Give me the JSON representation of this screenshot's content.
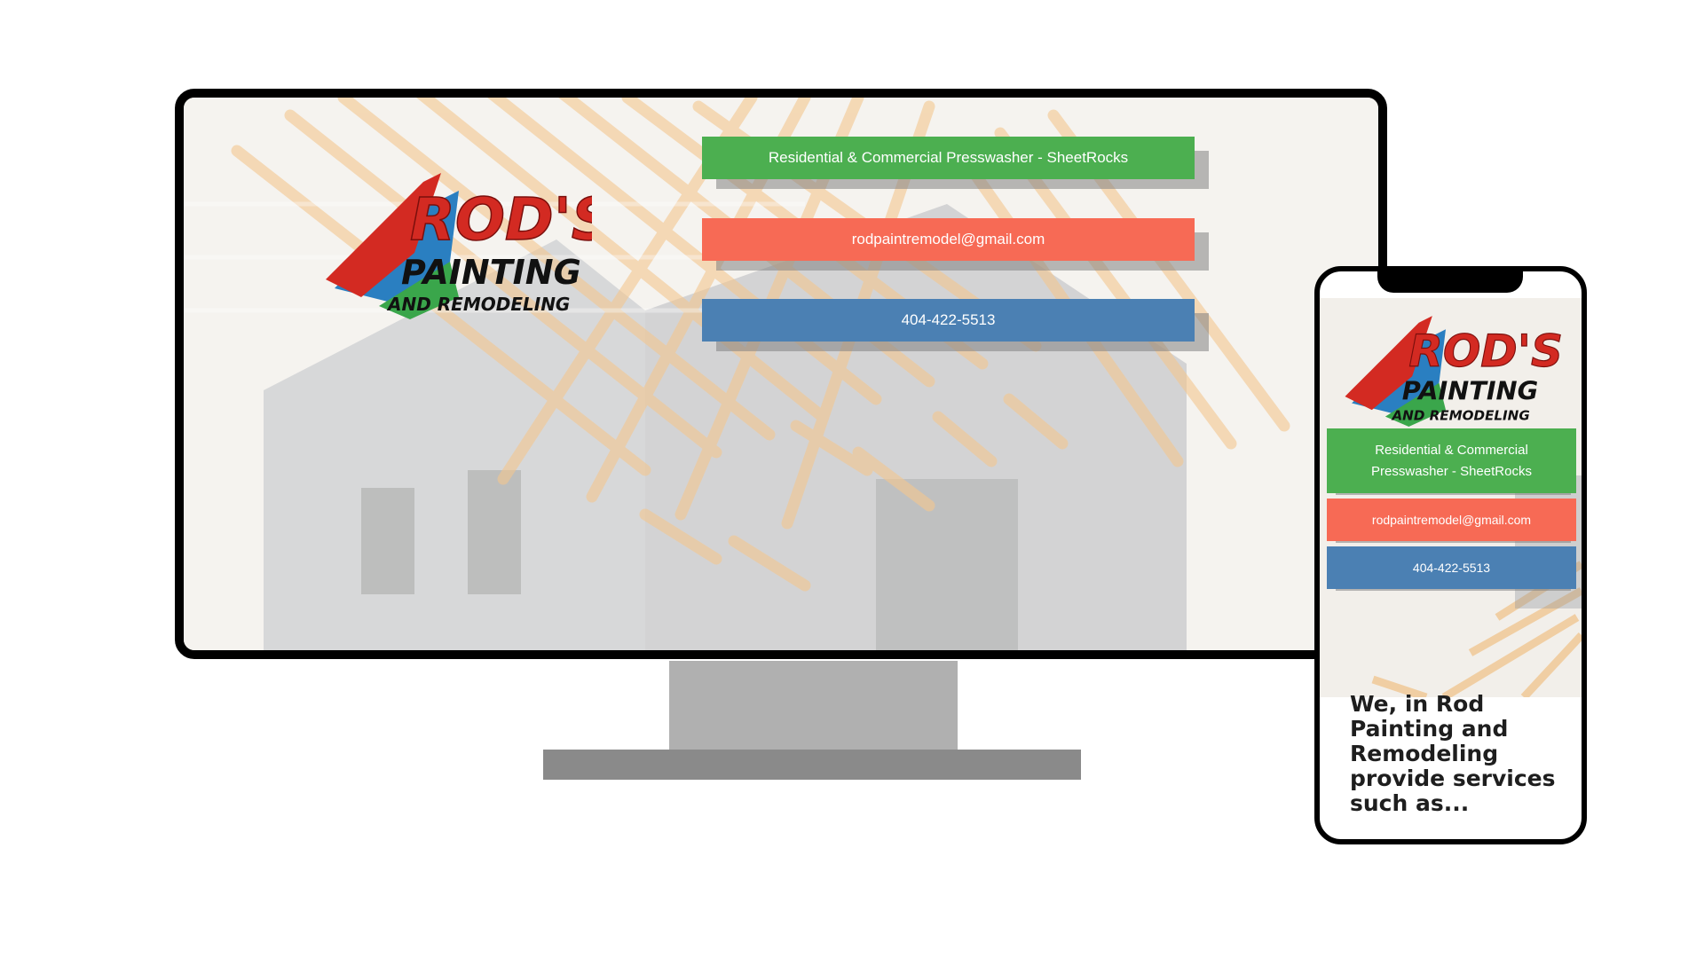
{
  "brand": {
    "logo_line1": "ROD'S",
    "logo_line2": "PAINTING",
    "logo_line3": "AND REMODELING"
  },
  "buttons": {
    "services": "Residential & Commercial Presswasher - SheetRocks",
    "services_mobile_line1": "Residential & Commercial",
    "services_mobile_line2": "Presswasher - SheetRocks",
    "email": "rodpaintremodel@gmail.com",
    "phone": "404-422-5513"
  },
  "mobile": {
    "intro": "We, in Rod Painting and Remodeling provide services such as..."
  },
  "colors": {
    "green": "#4caf50",
    "red": "#f76a55",
    "blue": "#4b80b3",
    "logo_red": "#d32a22"
  }
}
